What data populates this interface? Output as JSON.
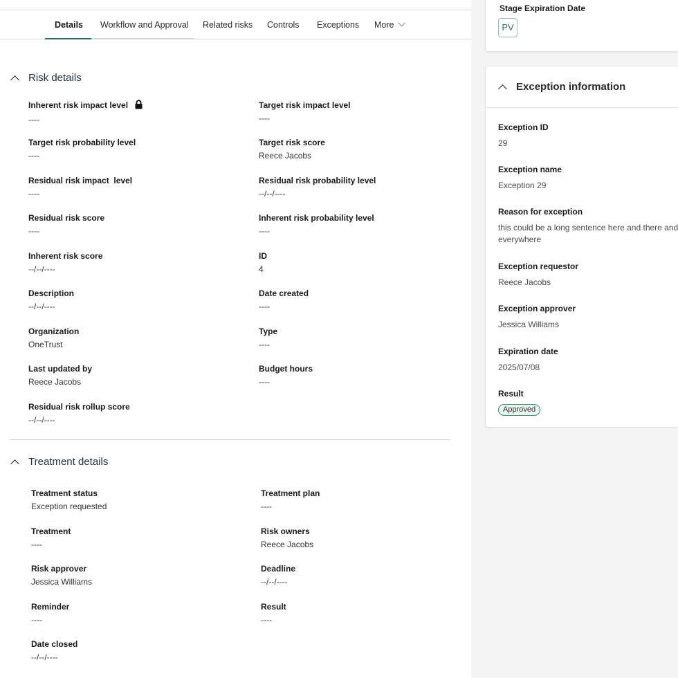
{
  "tabs": [
    {
      "label": "Details"
    },
    {
      "label": "Workflow and Approval"
    },
    {
      "label": "Related risks"
    },
    {
      "label": "Controls"
    },
    {
      "label": "Exceptions"
    },
    {
      "label": "More"
    }
  ],
  "risk_details": {
    "title": "Risk details",
    "fields": [
      {
        "label": "Inherent risk impact level",
        "value": "----"
      },
      {
        "label": "Target risk impact level",
        "value": "----"
      },
      {
        "label": "Target risk probability level",
        "value": "----"
      },
      {
        "label": "Target risk score",
        "value": "Reece Jacobs"
      },
      {
        "label": "Residual risk impact  level",
        "value": "----"
      },
      {
        "label": "Residual risk probability level",
        "value": "--/--/----"
      },
      {
        "label": "Residual risk score",
        "value": "----"
      },
      {
        "label": "Inherent risk probability level",
        "value": "----"
      },
      {
        "label": "Inherent risk score",
        "value": "--/--/----"
      },
      {
        "label": "ID",
        "value": "4"
      },
      {
        "label": "Description",
        "value": "--/--/----"
      },
      {
        "label": "Date created",
        "value": "----"
      },
      {
        "label": "Organization",
        "value": "OneTrust"
      },
      {
        "label": "Type",
        "value": "----"
      },
      {
        "label": "Last updated by",
        "value": "Reece Jacobs"
      },
      {
        "label": "Budget hours",
        "value": "----"
      },
      {
        "label": "Residual risk rollup score",
        "value": "--/--/----"
      }
    ]
  },
  "treatment_details": {
    "title": "Treatment details",
    "fields": [
      {
        "label": "Treatment status",
        "value": "Exception requested"
      },
      {
        "label": "Treatment plan",
        "value": "----"
      },
      {
        "label": "Treatment",
        "value": "----"
      },
      {
        "label": "Risk owners",
        "value": "Reece Jacobs"
      },
      {
        "label": "Risk approver",
        "value": "Jessica Williams"
      },
      {
        "label": "Deadline",
        "value": "--/--/----"
      },
      {
        "label": "Reminder",
        "value": "----"
      },
      {
        "label": "Result",
        "value": "----"
      },
      {
        "label": "Date closed",
        "value": "--/--/----"
      }
    ]
  },
  "stage": {
    "label": "Stage Expiration Date",
    "avatar_initials": "PV"
  },
  "exception_info": {
    "title": "Exception information",
    "fields": [
      {
        "label": "Exception ID",
        "value": "29"
      },
      {
        "label": "Exception name",
        "value": "Exception 29"
      },
      {
        "label": "Reason for exception",
        "value": "this could be a long sentence here and there and everywhere"
      },
      {
        "label": "Exception requestor",
        "value": "Reece Jacobs"
      },
      {
        "label": "Exception approver",
        "value": "Jessica Williams"
      },
      {
        "label": "Expiration date",
        "value": "2025/07/08"
      },
      {
        "label": "Result",
        "value": "Approved"
      }
    ]
  },
  "icons": {
    "lock": "lock-icon",
    "collapse": "chevron-up-icon",
    "more": "chevron-down-icon"
  },
  "colors": {
    "accent": "#2f6f5e",
    "approved_bg": "#eaf6f0"
  }
}
